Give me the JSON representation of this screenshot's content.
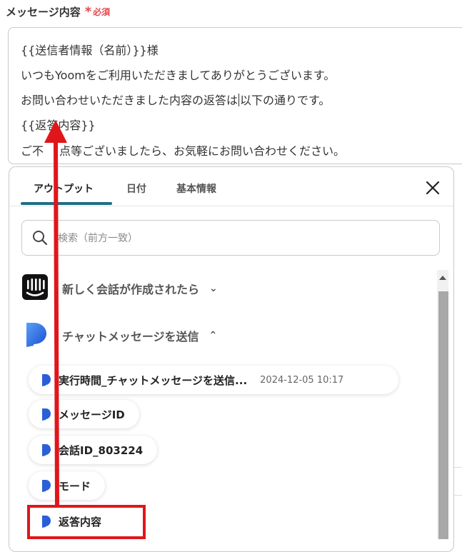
{
  "field": {
    "label": "メッセージ内容",
    "required_star": "*",
    "required_text": "必須"
  },
  "message_lines": [
    "{{送信者情報（名前）}}様",
    "いつもYoomをご利用いただきましてありがとうございます。",
    "お問い合わせいただきました内容の返答は",
    "以下の通りです。",
    "{{返答内容}}",
    "ご不",
    "点等ございましたら、お気軽にお問い合わせください。"
  ],
  "tabs": [
    {
      "label": "アウトプット",
      "active": true
    },
    {
      "label": "日付",
      "active": false
    },
    {
      "label": "基本情報",
      "active": false
    }
  ],
  "search": {
    "placeholder": "検索（前方一致）"
  },
  "sections": [
    {
      "title": "新しく会話が作成されたら",
      "chevron": "⌄",
      "icon": "intercom-icon"
    },
    {
      "title": "チャットメッセージを送信",
      "chevron": "⌃",
      "icon": "app-logo-icon"
    }
  ],
  "outputs": [
    {
      "label": "実行時間_チャットメッセージを送信...",
      "meta": "2024-12-05 10:17"
    },
    {
      "label": "メッセージID",
      "meta": ""
    },
    {
      "label": "会話ID_803224",
      "meta": ""
    },
    {
      "label": "モード",
      "meta": ""
    },
    {
      "label": "返答内容",
      "meta": ""
    }
  ],
  "colors": {
    "accent_tab": "#1f6e86",
    "required": "#e5484d",
    "highlight": "#e0161b",
    "arrow": "#e0161b"
  }
}
